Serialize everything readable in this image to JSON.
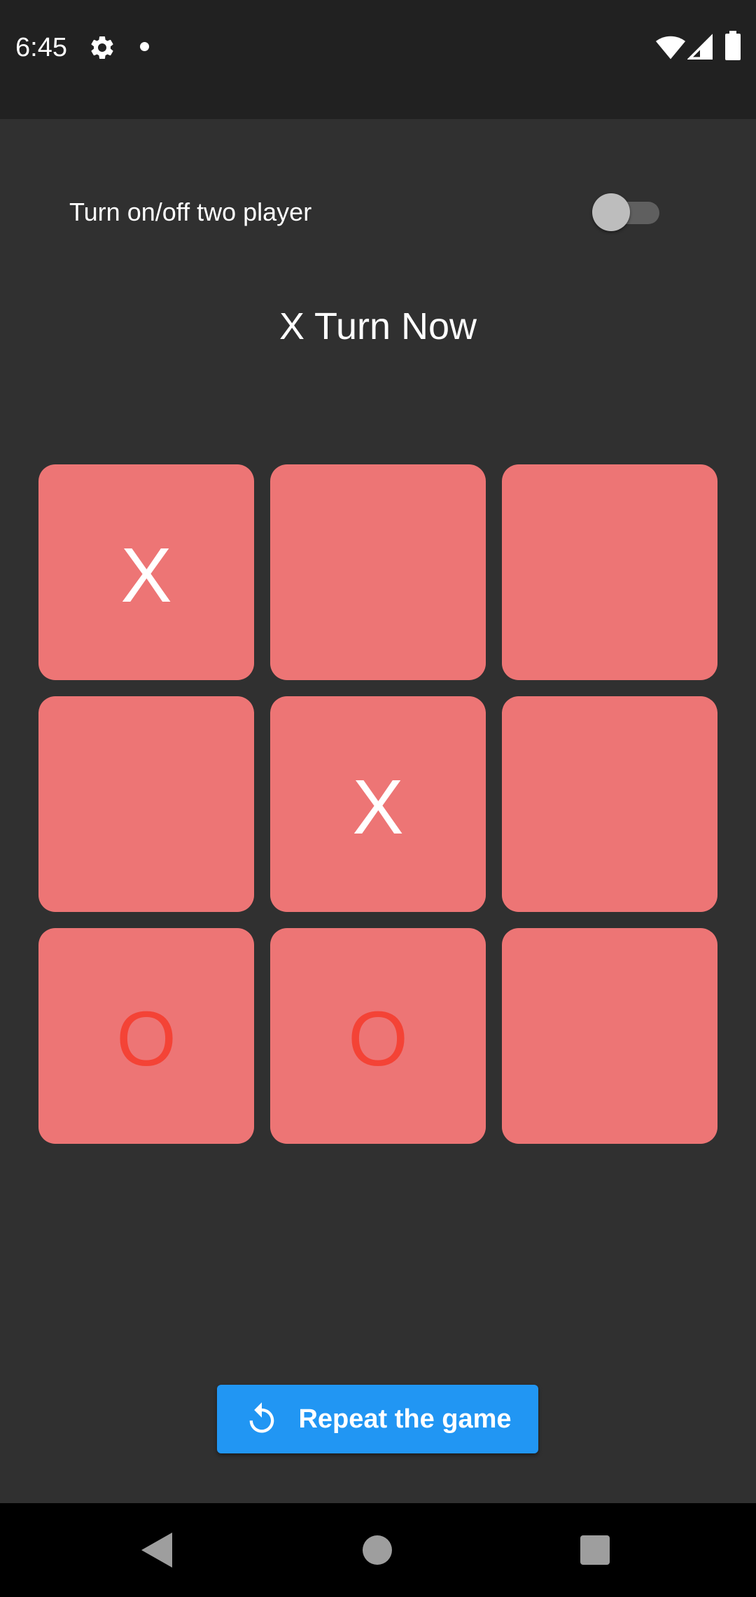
{
  "status_bar": {
    "time": "6:45",
    "icons": [
      "gear-icon",
      "dot-icon",
      "wifi-icon",
      "signal-icon",
      "battery-icon"
    ]
  },
  "two_player": {
    "label": "Turn on/off two player",
    "enabled": false
  },
  "turn_text": "X Turn Now",
  "board": {
    "cells": [
      "X",
      "",
      "",
      "",
      "X",
      "",
      "O",
      "O",
      ""
    ]
  },
  "repeat_button": {
    "label": "Repeat the game",
    "icon": "replay-icon"
  },
  "nav_bar": {
    "icons": [
      "back-icon",
      "home-icon",
      "recents-icon"
    ]
  },
  "colors": {
    "background": "#303030",
    "status_bar": "#212121",
    "cell": "#ed7575",
    "x_mark": "#ffffff",
    "o_mark": "#f44336",
    "button": "#2196f3"
  }
}
